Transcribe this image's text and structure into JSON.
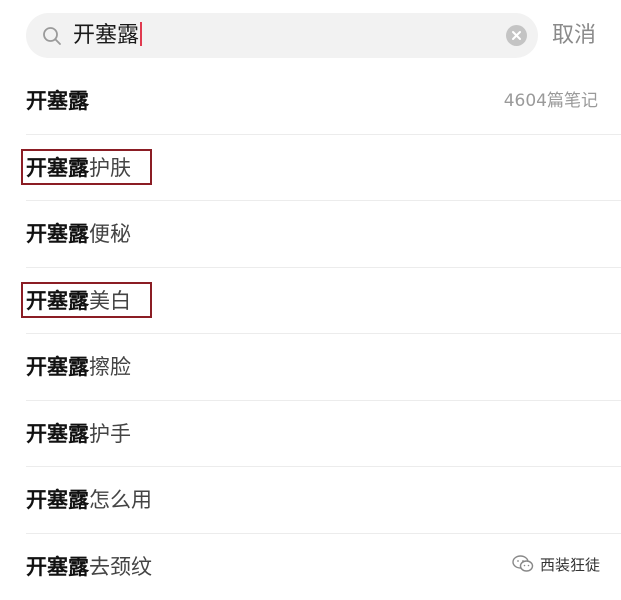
{
  "search": {
    "query": "开塞露",
    "cancel_label": "取消"
  },
  "suggestions": [
    {
      "keyword": "开塞露",
      "suffix": "",
      "count": "4604篇笔记",
      "highlighted": false
    },
    {
      "keyword": "开塞露",
      "suffix": "护肤",
      "count": "",
      "highlighted": true
    },
    {
      "keyword": "开塞露",
      "suffix": "便秘",
      "count": "",
      "highlighted": false
    },
    {
      "keyword": "开塞露",
      "suffix": "美白",
      "count": "",
      "highlighted": true
    },
    {
      "keyword": "开塞露",
      "suffix": "擦脸",
      "count": "",
      "highlighted": false
    },
    {
      "keyword": "开塞露",
      "suffix": "护手",
      "count": "",
      "highlighted": false
    },
    {
      "keyword": "开塞露",
      "suffix": "怎么用",
      "count": "",
      "highlighted": false
    },
    {
      "keyword": "开塞露",
      "suffix": "去颈纹",
      "count": "",
      "highlighted": false
    }
  ],
  "watermark": {
    "text": "西装狂徒"
  },
  "colors": {
    "search_bg": "#f2f2f2",
    "caret": "#e03a4f",
    "highlight_border": "#8b1d24",
    "muted_text": "#9a9a9a"
  },
  "icons": {
    "search": "search-icon",
    "clear": "clear-icon",
    "watermark": "wechat-icon"
  }
}
